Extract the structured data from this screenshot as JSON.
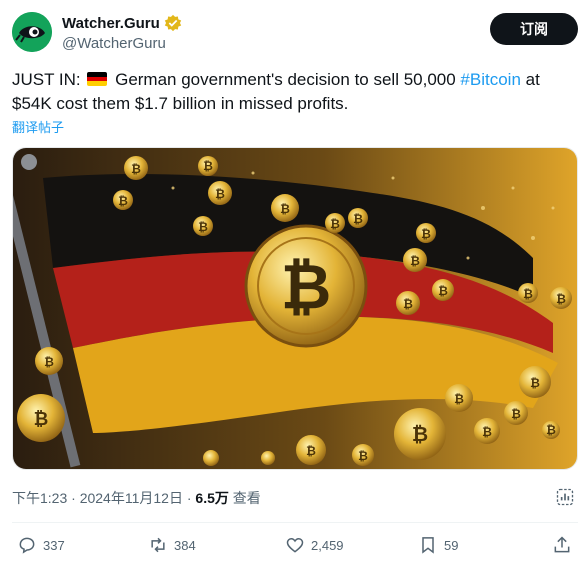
{
  "account": {
    "display_name": "Watcher.Guru",
    "handle": "@WatcherGuru",
    "verified_badge": "gold-verified-check",
    "avatar_icon": "eye-avatar-logo"
  },
  "follow_label": "订阅",
  "tweet": {
    "text_prefix": "JUST IN: ",
    "flag": "germany-flag",
    "text_main": " German government's decision to sell 50,000 ",
    "hashtag": "#Bitcoin",
    "text_suffix": " at $54K cost them $1.7 billion in missed profits.",
    "translate_label": "翻译帖子"
  },
  "media": {
    "image_description_icon": "bitcoin-german-flag-image"
  },
  "meta": {
    "time": "下午1:23",
    "separator": " · ",
    "date": "2024年11月12日",
    "views_count": "6.5万",
    "views_label": " 查看"
  },
  "actions": {
    "replies": "337",
    "reposts": "384",
    "likes": "2,459",
    "bookmarks": "59"
  },
  "colors": {
    "accent": "#1d9bf0",
    "text": "#0f1419",
    "muted": "#536471",
    "follow_bg": "#0f1419"
  }
}
